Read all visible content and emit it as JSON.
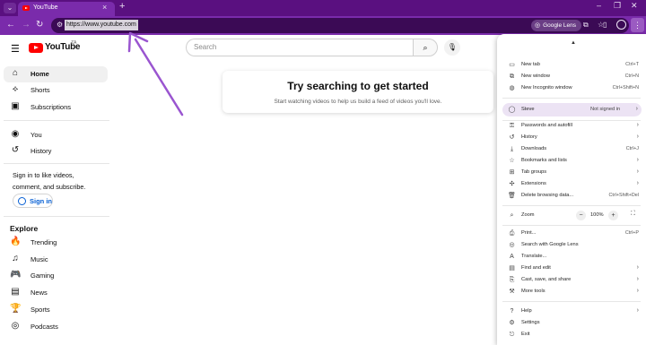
{
  "browser": {
    "tab_title": "YouTube",
    "new_tab_symbol": "+",
    "tab_close_symbol": "×",
    "url": "https://www.youtube.com",
    "lens_chip_label": "Google Lens"
  },
  "youtube": {
    "brand": "YouTube",
    "country_code": "ZA",
    "search_placeholder": "Search",
    "sidebar_primary": [
      {
        "label": "Home",
        "icon": "home-icon",
        "active": true
      },
      {
        "label": "Shorts",
        "icon": "shorts-icon",
        "active": false
      },
      {
        "label": "Subscriptions",
        "icon": "subscriptions-icon",
        "active": false
      }
    ],
    "sidebar_you": [
      {
        "label": "You",
        "icon": "you-icon"
      },
      {
        "label": "History",
        "icon": "history-icon"
      }
    ],
    "signin_prompt": "Sign in to like videos, comment, and subscribe.",
    "signin_label": "Sign in",
    "explore_title": "Explore",
    "explore_items": [
      {
        "label": "Trending",
        "icon": "trending-icon"
      },
      {
        "label": "Music",
        "icon": "music-icon"
      },
      {
        "label": "Gaming",
        "icon": "gaming-icon"
      },
      {
        "label": "News",
        "icon": "news-icon"
      },
      {
        "label": "Sports",
        "icon": "sports-icon"
      },
      {
        "label": "Podcasts",
        "icon": "podcasts-icon"
      }
    ],
    "empty_title": "Try searching to get started",
    "empty_subtitle": "Start watching videos to help us build a feed of videos you'll love."
  },
  "menu": {
    "group1": [
      {
        "label": "New tab",
        "shortcut": "Ctrl+T",
        "icon": "new-tab-icon"
      },
      {
        "label": "New window",
        "shortcut": "Ctrl+N",
        "icon": "new-window-icon"
      },
      {
        "label": "New Incognito window",
        "shortcut": "Ctrl+Shift+N",
        "icon": "incognito-icon"
      }
    ],
    "profile": {
      "name": "Steve",
      "status": "Not signed in"
    },
    "group2": [
      {
        "label": "Passwords and autofill",
        "icon": "key-icon",
        "submenu": true
      },
      {
        "label": "History",
        "icon": "history-icon",
        "submenu": true
      },
      {
        "label": "Downloads",
        "shortcut": "Ctrl+J",
        "icon": "download-icon"
      },
      {
        "label": "Bookmarks and lists",
        "icon": "star-icon",
        "submenu": true
      },
      {
        "label": "Tab groups",
        "icon": "tab-groups-icon",
        "submenu": true
      },
      {
        "label": "Extensions",
        "icon": "extensions-icon",
        "submenu": true
      },
      {
        "label": "Delete browsing data...",
        "shortcut": "Ctrl+Shift+Del",
        "icon": "trash-icon"
      }
    ],
    "zoom": {
      "label": "Zoom",
      "value": "100%"
    },
    "group3": [
      {
        "label": "Print...",
        "shortcut": "Ctrl+P",
        "icon": "print-icon"
      },
      {
        "label": "Search with Google Lens",
        "icon": "lens-icon"
      },
      {
        "label": "Translate...",
        "icon": "translate-icon"
      },
      {
        "label": "Find and edit",
        "icon": "find-icon",
        "submenu": true
      },
      {
        "label": "Cast, save, and share",
        "icon": "cast-icon",
        "submenu": true
      },
      {
        "label": "More tools",
        "icon": "tools-icon",
        "submenu": true
      }
    ],
    "group4": [
      {
        "label": "Help",
        "icon": "help-icon",
        "submenu": true
      },
      {
        "label": "Settings",
        "icon": "settings-icon"
      },
      {
        "label": "Exit",
        "icon": "exit-icon"
      }
    ]
  },
  "colors": {
    "chrome_frame": "#5a1080",
    "chrome_toolbar": "#7a2bab",
    "annotation_arrow": "#9a55d0",
    "youtube_red": "#ff0000",
    "link_blue": "#065fd4"
  }
}
